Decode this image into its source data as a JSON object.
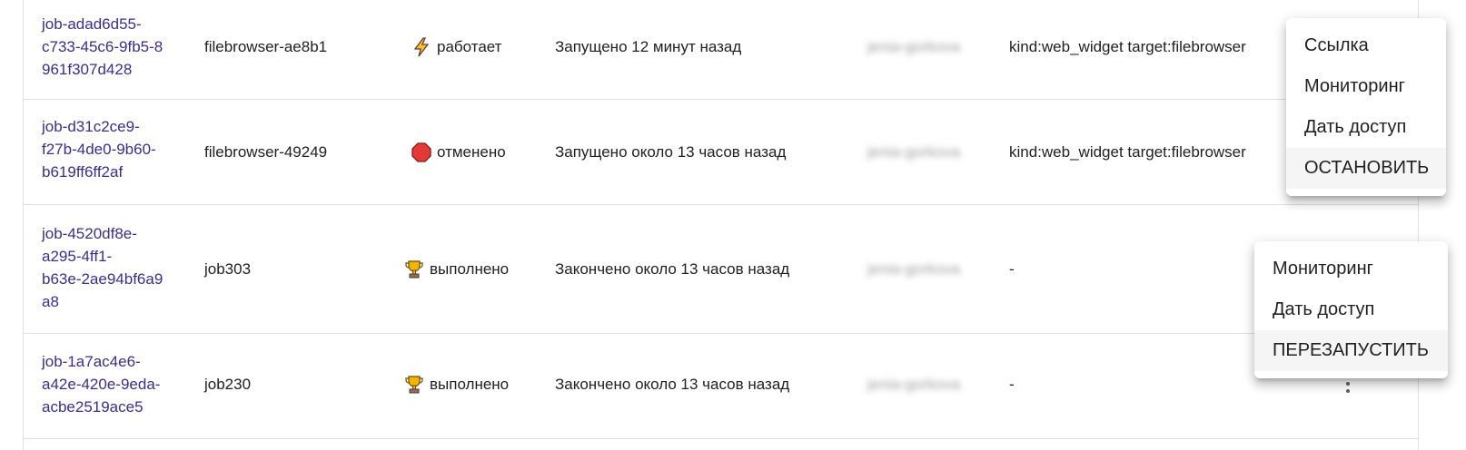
{
  "rows": [
    {
      "id_lines": [
        "job-adad6d55-",
        "c733-45c6-9fb5-8",
        "961f307d428"
      ],
      "name": "filebrowser-ae8b1",
      "status": {
        "label": "работает",
        "icon": "lightning-icon"
      },
      "time": "Запущено 12 минут назад",
      "owner": "jenia-gorkova",
      "tags": "kind:web_widget target:filebrowser"
    },
    {
      "id_lines": [
        "job-d31c2ce9-",
        "f27b-4de0-9b60-",
        "b619ff6ff2af"
      ],
      "name": "filebrowser-49249",
      "status": {
        "label": "отменено",
        "icon": "stop-sign-icon"
      },
      "time": "Запущено около 13 часов назад",
      "owner": "jenia-gorkova",
      "tags": "kind:web_widget target:filebrowser"
    },
    {
      "id_lines": [
        "job-4520df8e-",
        "a295-4ff1-",
        "b63e-2ae94bf6a9",
        "a8"
      ],
      "name": "job303",
      "status": {
        "label": "выполнено",
        "icon": "trophy-icon"
      },
      "time": "Закончено около 13 часов назад",
      "owner": "jenia-gorkova",
      "tags": "-"
    },
    {
      "id_lines": [
        "job-1a7ac4e6-",
        "a42e-420e-9eda-",
        "acbe2519ace5"
      ],
      "name": "job230",
      "status": {
        "label": "выполнено",
        "icon": "trophy-icon"
      },
      "time": "Закончено около 13 часов назад",
      "owner": "jenia-gorkova",
      "tags": "-"
    }
  ],
  "menu_running": {
    "items": [
      "Ссылка",
      "Мониторинг",
      "Дать доступ",
      "ОСТАНОВИТЬ"
    ]
  },
  "menu_finished": {
    "items": [
      "Мониторинг",
      "Дать доступ",
      "ПЕРЕЗАПУСТИТЬ"
    ]
  },
  "colors": {
    "link": "#3b2f8a",
    "stop": "#e53935",
    "trophy": "#f4b400",
    "lightning": "#fbc02d",
    "highlight": "#f5f5f5"
  }
}
